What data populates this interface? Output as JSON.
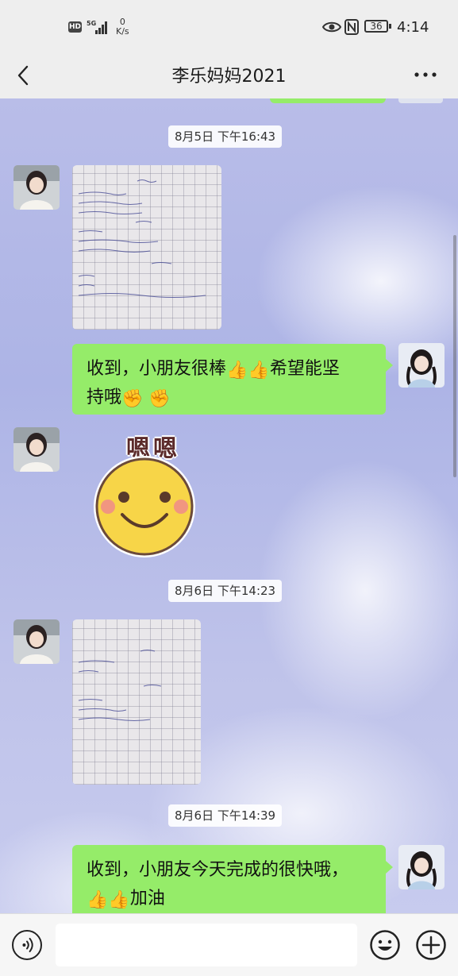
{
  "status_bar": {
    "hd_badge": "HD",
    "network": "5G",
    "speed_value": "0",
    "speed_unit": "K/s",
    "battery": "36",
    "time": "4:14"
  },
  "header": {
    "title": "李乐妈妈2021"
  },
  "messages": {
    "ts1": "8月5日 下午16:43",
    "reply1_text_a": "收到，小朋友很棒",
    "reply1_text_b": "希望能坚",
    "reply1_text_c": "持哦",
    "sticker_text": "嗯嗯",
    "ts2": "8月6日 下午14:23",
    "ts3": "8月6日 下午14:39",
    "reply2_text_a": "收到，小朋友今天完成的很快哦，",
    "reply2_text_b": "加油"
  },
  "emoji": {
    "thumbs_up": "👍",
    "fist": "✊"
  },
  "input": {
    "placeholder": ""
  },
  "colors": {
    "bubble_green": "#95ec69",
    "bar_gray": "#eeeeee",
    "chat_bg": "#b9bde8"
  },
  "icons": {
    "back": "chevron-left-icon",
    "more": "more-dots-icon",
    "voice": "voice-icon",
    "emoji": "smiley-face-icon",
    "plus": "plus-icon"
  }
}
